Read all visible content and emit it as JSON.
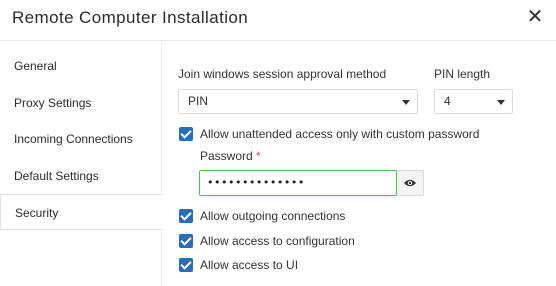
{
  "dialog": {
    "title": "Remote Computer Installation",
    "close_symbol": "✕"
  },
  "sidebar": {
    "items": [
      {
        "label": "General"
      },
      {
        "label": "Proxy Settings"
      },
      {
        "label": "Incoming Connections"
      },
      {
        "label": "Default Settings"
      },
      {
        "label": "Security",
        "active": true
      }
    ]
  },
  "security": {
    "approval_method_label": "Join windows session approval method",
    "approval_method_value": "PIN",
    "pin_length_label": "PIN length",
    "pin_length_value": "4",
    "unattended_label": "Allow unattended access only with custom password",
    "unattended_checked": true,
    "password_label": "Password",
    "password_required_mark": "*",
    "password_value": "••••••••••••••",
    "outgoing_label": "Allow outgoing connections",
    "outgoing_checked": true,
    "config_label": "Allow access to configuration",
    "config_checked": true,
    "ui_label": "Allow access to UI",
    "ui_checked": true
  },
  "colors": {
    "checkbox": "#2a6db5",
    "valid_border": "#5cb85c",
    "required": "#d9534f"
  },
  "icons": {
    "close": "close-icon",
    "reveal": "eye-icon",
    "dropdown": "chevron-down-icon"
  }
}
